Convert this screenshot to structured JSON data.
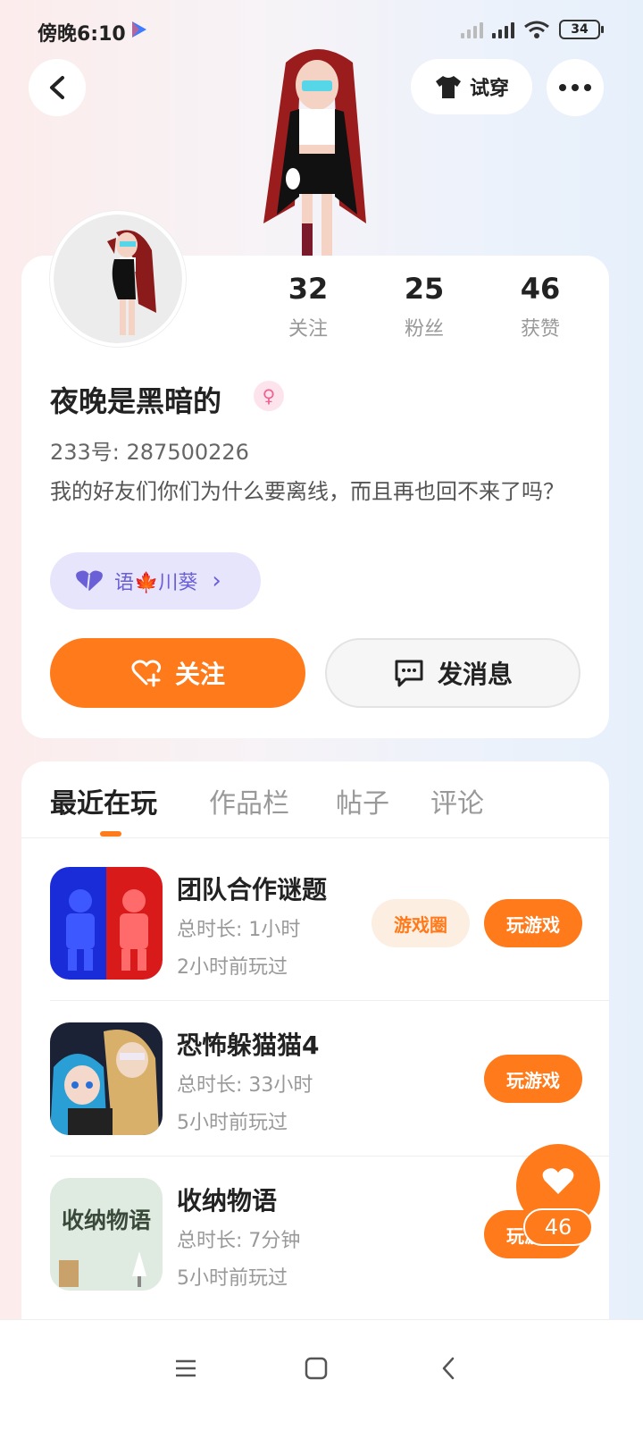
{
  "status_bar": {
    "time": "傍晚6:10",
    "battery": "34",
    "icons": [
      "play-store-icon",
      "signal-icon",
      "signal-icon",
      "wifi-icon",
      "battery-icon"
    ]
  },
  "header": {
    "back_icon": "chevron-left-icon",
    "tryon_label": "试穿",
    "tryon_icon": "tshirt-icon",
    "more_icon": "more-dots-icon"
  },
  "profile": {
    "stats": [
      {
        "value": "32",
        "label": "关注"
      },
      {
        "value": "25",
        "label": "粉丝"
      },
      {
        "value": "46",
        "label": "获赞"
      }
    ],
    "name": "夜晚是黑暗的",
    "gender_icon": "female-icon",
    "id_text": "233号: 287500226",
    "bio": "我的好友们你们为什么要离线，而且再也回不来了吗？",
    "tag": {
      "text": "语🍁川葵",
      "icon": "heart-icon",
      "arrow": "›"
    },
    "follow_label": "关注",
    "message_label": "发消息"
  },
  "tabs": [
    "最近在玩",
    "作品栏",
    "帖子",
    "评论"
  ],
  "games": [
    {
      "title": "团队合作谜题",
      "duration": "总时长: 1小时",
      "last_played": "2小时前玩过",
      "circle_label": "游戏圈",
      "play_label": "玩游戏"
    },
    {
      "title": "恐怖躲猫猫4",
      "duration": "总时长: 33小时",
      "last_played": "5小时前玩过",
      "play_label": "玩游戏"
    },
    {
      "title": "收纳物语",
      "duration": "总时长: 7分钟",
      "last_played": "5小时前玩过",
      "play_label": "玩游戏",
      "icon_text": "收纳物语"
    }
  ],
  "floating_like": {
    "count": "46",
    "icon": "heart-icon"
  },
  "nav": [
    "menu-icon",
    "home-square-icon",
    "back-chevron-icon"
  ],
  "colors": {
    "accent": "#ff7a1a",
    "tag_bg": "#e7e5fb",
    "tag_text": "#6a5fd6"
  }
}
